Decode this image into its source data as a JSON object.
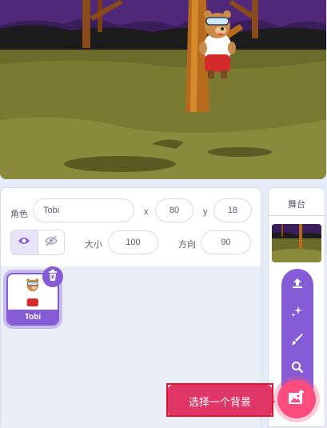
{
  "stage": {
    "sprite_name": "Tobi"
  },
  "sprite_info": {
    "sprite_label": "角色",
    "sprite_name_value": "Tobi",
    "x_label": "x",
    "x_value": "80",
    "y_label": "y",
    "y_value": "18",
    "size_label": "大小",
    "size_value": "100",
    "direction_label": "方向",
    "direction_value": "90",
    "show_icon": "eye-icon",
    "hide_icon": "eye-slash-icon"
  },
  "sprite_list": {
    "items": [
      {
        "name": "Tobi",
        "selected": true
      }
    ],
    "delete_icon": "trash-icon"
  },
  "stage_selector": {
    "title": "舞台"
  },
  "backdrop_menu": {
    "items": [
      "upload-icon",
      "surprise-icon",
      "paint-icon",
      "search-icon"
    ],
    "choose_button_icon": "backdrop-icon",
    "tooltip": "选择一个背景"
  },
  "colors": {
    "accent": "#855cd6",
    "backdrop_button": "#ff4c7f",
    "tooltip_bg": "#e03567",
    "highlight": "#e0142e"
  }
}
